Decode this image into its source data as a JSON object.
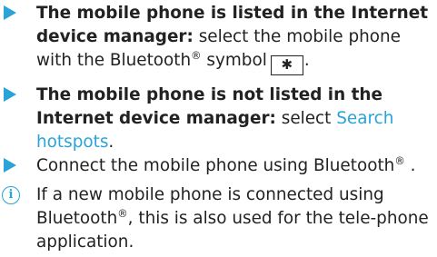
{
  "items": [
    {
      "lead": "The mobile phone is listed in the Internet device manager:",
      "body": "select the mobile phone with the Bluetooth",
      "sup": "®",
      "body2": "symbol",
      "key_icon": "bluetooth-icon",
      "end": "."
    },
    {
      "lead": "The mobile phone is not listed in the Internet device manager:",
      "body": "select",
      "link": "Search hotspots",
      "end": "."
    },
    {
      "body": "Connect the mobile phone using Bluetooth",
      "sup": "®",
      "end": " ."
    }
  ],
  "note": {
    "icon": "info-icon",
    "text1": "If a new mobile phone is connected using Bluetooth",
    "sup": "®",
    "text2": ", this is also used for the tele-phone application."
  },
  "colors": {
    "accent": "#29a3d8",
    "text": "#222222"
  }
}
